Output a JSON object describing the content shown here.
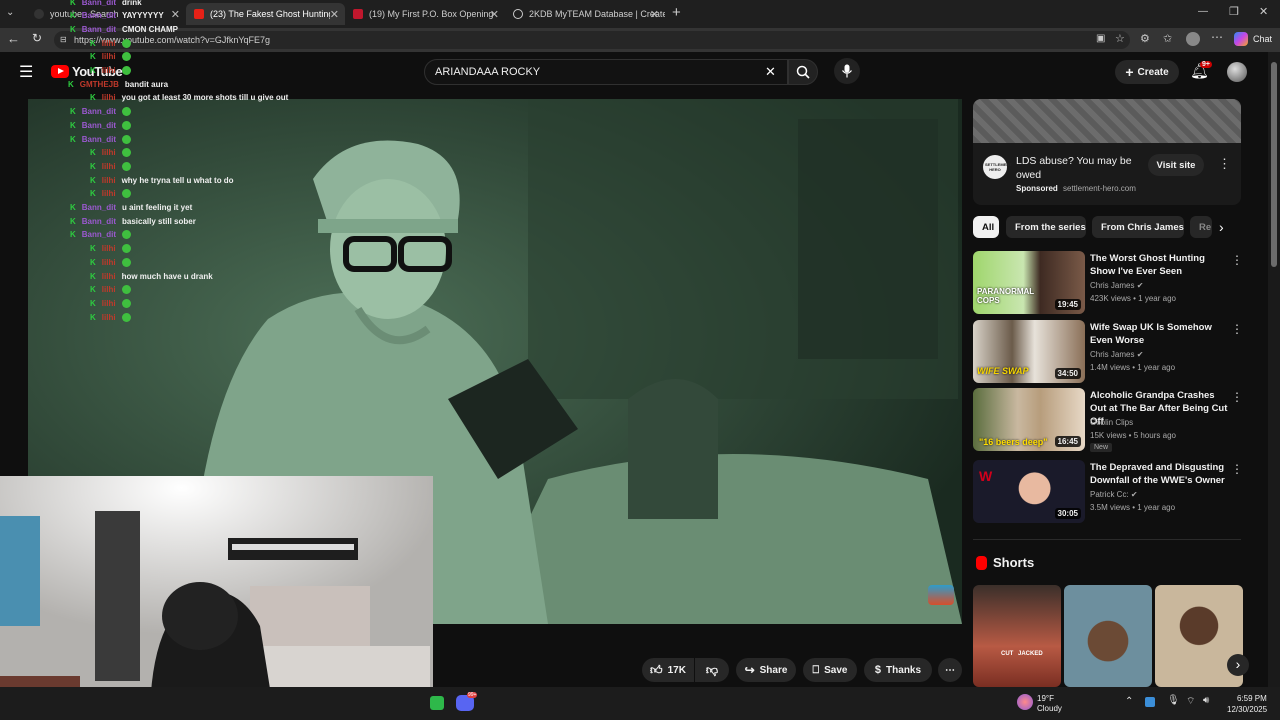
{
  "browser": {
    "tabs": [
      {
        "label": "youtube - Search"
      },
      {
        "label": "(23) The Fakest Ghost Hunting Show"
      },
      {
        "label": "(19) My First P.O. Box Opening.. - Y"
      },
      {
        "label": "2KDB MyTEAM Database | Create"
      }
    ],
    "url": "https://www.youtube.com/watch?v=GJfknYqFE7g",
    "chat_button": "Chat"
  },
  "youtube": {
    "logo_text": "YouTube",
    "search_value": "ARIANDAAA ROCKY",
    "create_label": "Create",
    "notif_count": "9+"
  },
  "stream_chat": [
    {
      "user": "Bann_dit",
      "msg": "drink",
      "color": "#9b59d0",
      "indent": 1
    },
    {
      "user": "Bann_dit",
      "msg": "YAYYYYYY",
      "color": "#9b59d0",
      "indent": 1
    },
    {
      "user": "Bann_dit",
      "msg": "CMON CHAMP",
      "color": "#9b59d0",
      "indent": 1
    },
    {
      "user": "lilhi",
      "msg": "",
      "emote": true,
      "color": "#c0392b",
      "indent": 2
    },
    {
      "user": "lilhi",
      "msg": "",
      "emote": true,
      "color": "#c0392b",
      "indent": 2
    },
    {
      "user": "lilhi",
      "msg": "",
      "emote": true,
      "color": "#c0392b",
      "indent": 2
    },
    {
      "user": "GMTHEJB",
      "msg": "bandit aura",
      "color": "#c0392b",
      "indent": 0
    },
    {
      "user": "lilhi",
      "msg": "you got at least 30 more shots till u give out",
      "color": "#c0392b",
      "indent": 2
    },
    {
      "user": "Bann_dit",
      "msg": "",
      "emote": true,
      "color": "#9b59d0",
      "indent": 1
    },
    {
      "user": "Bann_dit",
      "msg": "",
      "emote": true,
      "color": "#9b59d0",
      "indent": 1
    },
    {
      "user": "Bann_dit",
      "msg": "",
      "emote": true,
      "color": "#9b59d0",
      "indent": 1
    },
    {
      "user": "lilhi",
      "msg": "",
      "emote": true,
      "color": "#c0392b",
      "indent": 2
    },
    {
      "user": "lilhi",
      "msg": "",
      "emote": true,
      "color": "#c0392b",
      "indent": 2
    },
    {
      "user": "lilhi",
      "msg": "why he tryna tell u what to do",
      "color": "#c0392b",
      "indent": 2
    },
    {
      "user": "lilhi",
      "msg": "",
      "emote": true,
      "color": "#c0392b",
      "indent": 2
    },
    {
      "user": "Bann_dit",
      "msg": "u aint feeling it yet",
      "color": "#9b59d0",
      "indent": 1
    },
    {
      "user": "Bann_dit",
      "msg": "basically still sober",
      "color": "#9b59d0",
      "indent": 1
    },
    {
      "user": "Bann_dit",
      "msg": "",
      "emote": true,
      "color": "#9b59d0",
      "indent": 1
    },
    {
      "user": "lilhi",
      "msg": "",
      "emote": true,
      "color": "#c0392b",
      "indent": 2
    },
    {
      "user": "lilhi",
      "msg": "",
      "emote": true,
      "color": "#c0392b",
      "indent": 2
    },
    {
      "user": "lilhi",
      "msg": "how much have u drank",
      "color": "#c0392b",
      "indent": 2
    },
    {
      "user": "lilhi",
      "msg": "",
      "emote": true,
      "color": "#c0392b",
      "indent": 2
    },
    {
      "user": "lilhi",
      "msg": "",
      "emote": true,
      "color": "#c0392b",
      "indent": 2
    },
    {
      "user": "lilhi",
      "msg": "",
      "emote": true,
      "color": "#c0392b",
      "indent": 2
    }
  ],
  "actions": {
    "likes": "17K",
    "share": "Share",
    "save": "Save",
    "thanks": "Thanks"
  },
  "ad": {
    "title": "LDS abuse? You may be owed",
    "sponsored": "Sponsored",
    "domain": "settlement-hero.com",
    "cta": "Visit site",
    "logo_text": "SETTLEMENT HERO"
  },
  "chips": [
    "All",
    "From the series",
    "From Chris James",
    "Re"
  ],
  "recommendations": [
    {
      "title": "The Worst Ghost Hunting Show I've Ever Seen",
      "channel": "Chris James",
      "meta": "423K views • 1 year ago",
      "duration": "19:45",
      "verified": true
    },
    {
      "title": "Wife Swap UK Is Somehow Even Worse",
      "channel": "Chris James",
      "meta": "1.4M views • 1 year ago",
      "duration": "34:50",
      "verified": true
    },
    {
      "title": "Alcoholic Grandpa Crashes Out at The Bar After Being Cut Off",
      "channel": "Goblin Clips",
      "meta": "15K views • 5 hours ago",
      "duration": "16:45",
      "badge": "New",
      "verified": false
    },
    {
      "title": "The Depraved and Disgusting Downfall of the WWE's Owner",
      "channel": "Patrick Cc:",
      "meta": "3.5M views • 1 year ago",
      "duration": "30:05",
      "verified": true
    }
  ],
  "thumb_captions": [
    "PARANORMAL COPS",
    "WIFE SWAP",
    "\"16 beers deep\""
  ],
  "shorts_label": "Shorts",
  "short_captions": [
    "CUT",
    "JACKED"
  ],
  "taskbar": {
    "weather_temp": "19°F",
    "weather_desc": "Cloudy",
    "time": "6:59 PM",
    "date": "12/30/2025",
    "discord_badge": "99+"
  }
}
